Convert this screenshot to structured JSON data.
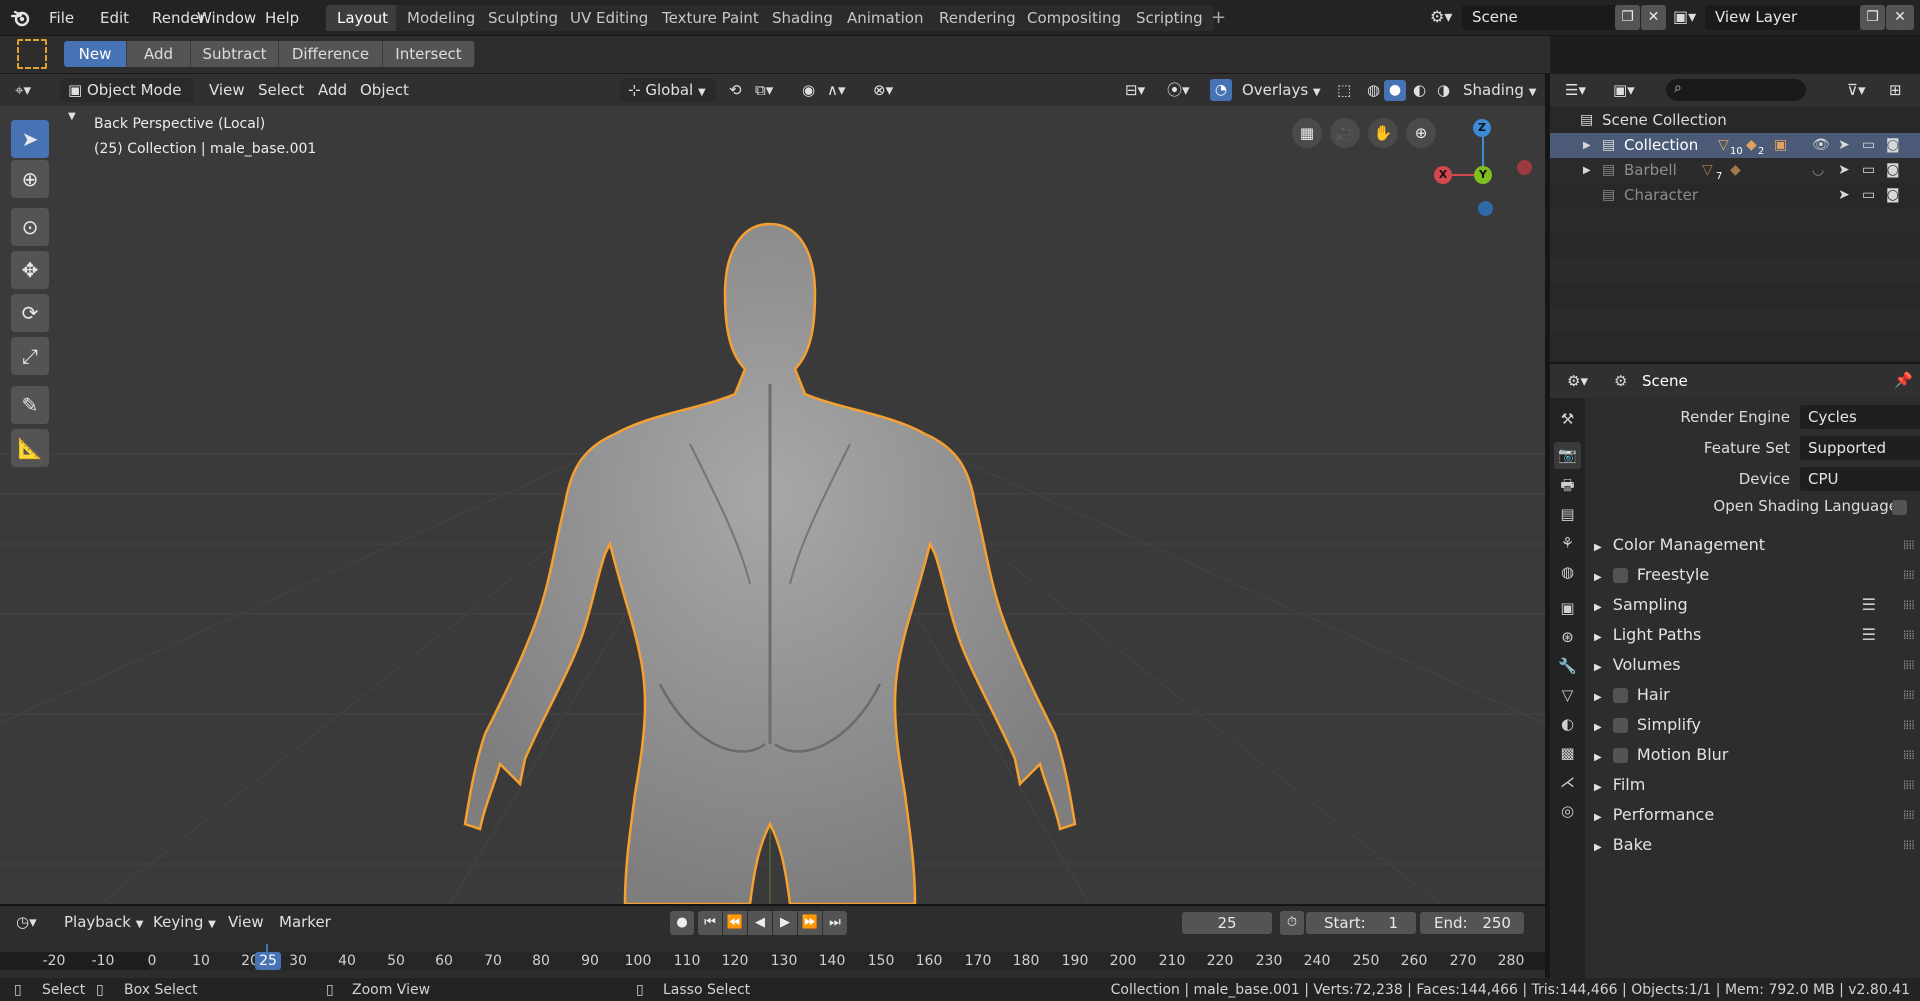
{
  "menu": {
    "items": [
      "File",
      "Edit",
      "Render",
      "Window",
      "Help"
    ]
  },
  "workspaces": [
    "Layout",
    "Modeling",
    "Sculpting",
    "UV Editing",
    "Texture Paint",
    "Shading",
    "Animation",
    "Rendering",
    "Compositing",
    "Scripting"
  ],
  "add_workspace": "+",
  "scene": {
    "name": "Scene"
  },
  "view_layer": {
    "name": "View Layer"
  },
  "toolheader": {
    "modes": [
      "New",
      "Add",
      "Subtract",
      "Difference",
      "Intersect"
    ]
  },
  "viewport": {
    "mode": "Object Mode",
    "menus": [
      "View",
      "Select",
      "Add",
      "Object"
    ],
    "transform": "Global",
    "overlays": "Overlays",
    "shading": "Shading",
    "info_line1": "Back Perspective (Local)",
    "info_line2": "(25) Collection | male_base.001",
    "gizmo": {
      "z": "Z",
      "x": "X",
      "y": "Y"
    }
  },
  "timeline": {
    "menus": [
      "Playback",
      "Keying",
      "View",
      "Marker"
    ],
    "current_frame": "25",
    "start_label": "Start:",
    "start_value": "1",
    "end_label": "End:",
    "end_value": "250",
    "ruler_ticks": [
      "-20",
      "-10",
      "0",
      "10",
      "20",
      "25",
      "30",
      "40",
      "50",
      "60",
      "70",
      "80",
      "90",
      "100",
      "110",
      "120",
      "130",
      "140",
      "150",
      "160",
      "170",
      "180",
      "190",
      "200",
      "210",
      "220",
      "230",
      "240",
      "250",
      "260",
      "270",
      "280"
    ]
  },
  "statusbar": {
    "select": "Select",
    "box_select": "Box Select",
    "zoom_view": "Zoom View",
    "lasso_select": "Lasso Select",
    "stats": "Collection | male_base.001 | Verts:72,238 | Faces:144,466 | Tris:144,466 | Objects:1/1 | Mem: 792.0 MB | v2.80.41"
  },
  "outliner": {
    "root": "Scene Collection",
    "rows": [
      {
        "name": "Collection",
        "badge1": "10",
        "badge2": "2"
      },
      {
        "name": "Barbell",
        "badge1": "7"
      },
      {
        "name": "Character"
      }
    ]
  },
  "properties": {
    "title": "Scene",
    "render_engine_label": "Render Engine",
    "render_engine": "Cycles",
    "feature_set_label": "Feature Set",
    "feature_set": "Supported",
    "device_label": "Device",
    "device": "CPU",
    "osl_label": "Open Shading Language",
    "panels": [
      "Color Management",
      "Freestyle",
      "Sampling",
      "Light Paths",
      "Volumes",
      "Hair",
      "Simplify",
      "Motion Blur",
      "Film",
      "Performance",
      "Bake"
    ]
  },
  "colors": {
    "accent": "#4772b3",
    "selection_outline": "#f5a030",
    "viewport_bg": "#3a3a3a"
  }
}
